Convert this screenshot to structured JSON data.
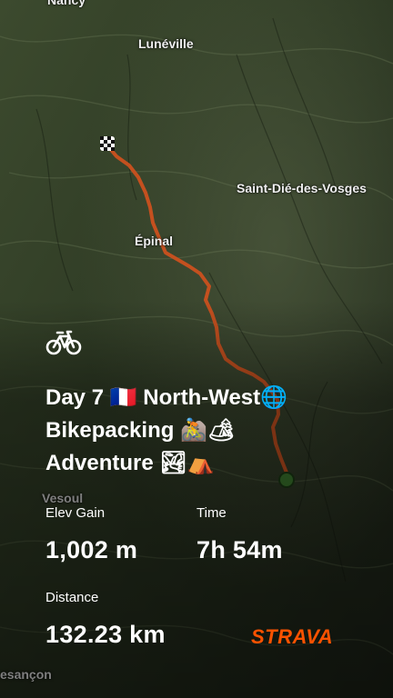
{
  "map": {
    "places": {
      "nancy": "Nancy",
      "luneville": "Lunéville",
      "saint_die": "Saint-Dié-des-Vosges",
      "epinal": "Épinal",
      "vesoul": "Vesoul",
      "besancon": "esançon"
    },
    "route_color": "#c4501f"
  },
  "activity": {
    "sport_icon": "bicycle-icon",
    "title_line1": "Day 7 🇫🇷 North-West🌐",
    "title_line2": "Bikepacking 🚵🏕",
    "title_line3": "Adventure 🏞⛺",
    "stats": {
      "elev_gain_label": "Elev Gain",
      "elev_gain_value": "1,002 m",
      "time_label": "Time",
      "time_value": "7h 54m",
      "distance_label": "Distance",
      "distance_value": "132.23 km"
    }
  },
  "brand": {
    "logo_text": "STRAVA",
    "color": "#fc5200"
  }
}
